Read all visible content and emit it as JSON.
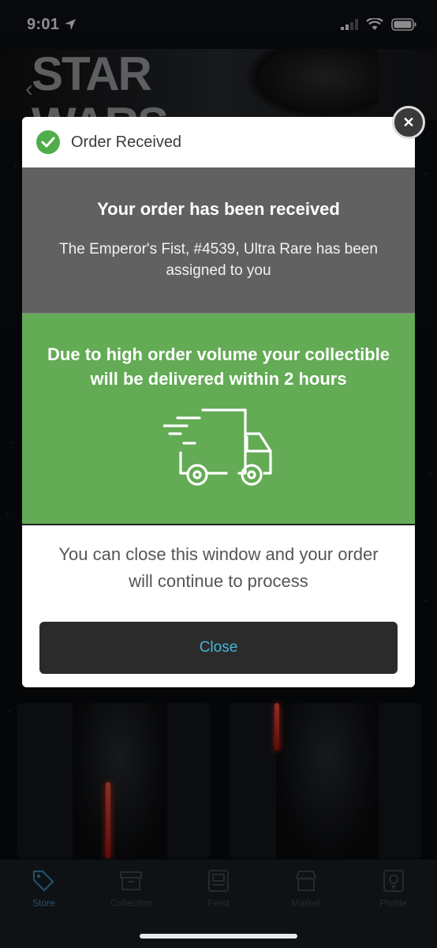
{
  "status_bar": {
    "time": "9:01"
  },
  "background": {
    "hero_logo_text": "STAR WARS"
  },
  "modal": {
    "header_title": "Order Received",
    "gray_title": "Your order has been received",
    "gray_text": "The Emperor's Fist, #4539, Ultra Rare has been assigned to you",
    "green_title": "Due to high order volume your collectible will be delivered within 2 hours",
    "white_text": "You can close this window and your order will continue to process",
    "close_label": "Close"
  },
  "tabs": [
    {
      "label": "Store",
      "icon": "tag-icon",
      "active": true
    },
    {
      "label": "Collection",
      "icon": "box-icon",
      "active": false
    },
    {
      "label": "Feed",
      "icon": "feed-icon",
      "active": false
    },
    {
      "label": "Market",
      "icon": "store-icon",
      "active": false
    },
    {
      "label": "Profile",
      "icon": "profile-icon",
      "active": false
    }
  ],
  "colors": {
    "success": "#4fae4a",
    "green_block": "#63ab55",
    "gray_block": "#616161",
    "accent": "#45b5d9"
  }
}
